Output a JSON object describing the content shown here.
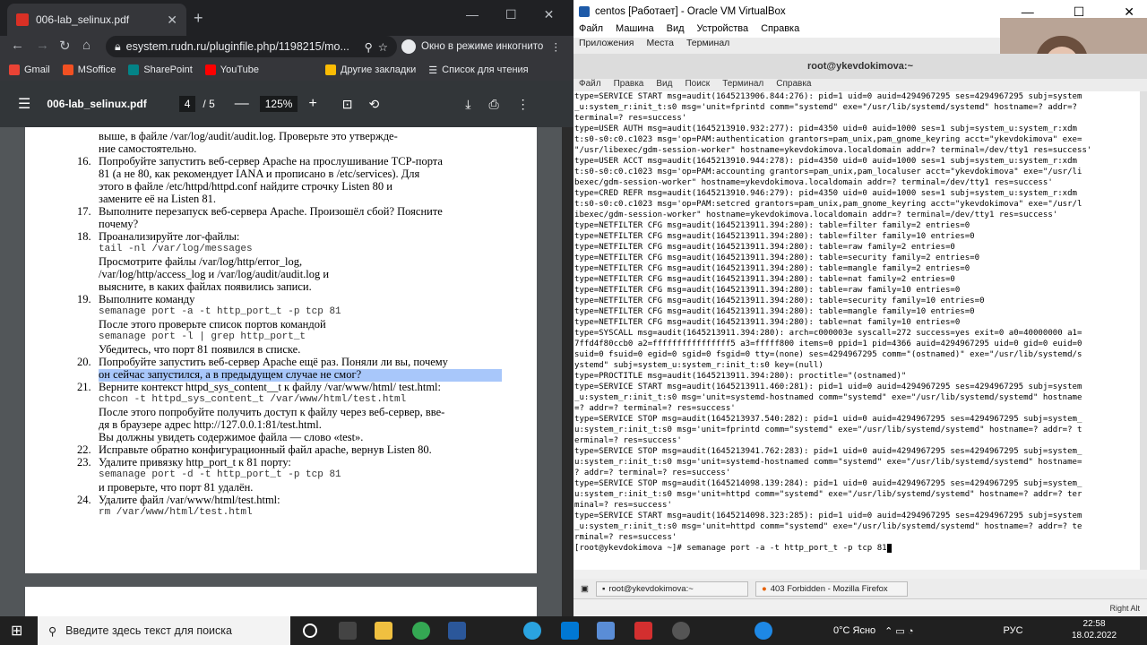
{
  "chrome": {
    "tab_title": "006-lab_selinux.pdf",
    "url": "esystem.rudn.ru/pluginfile.php/1198215/mo...",
    "incognito": "Окно в режиме инкогнито",
    "bookmarks": [
      "Gmail",
      "MSoffice",
      "SharePoint",
      "YouTube",
      "Другие закладки",
      "Список для чтения"
    ]
  },
  "pdf": {
    "title": "006-lab_selinux.pdf",
    "page": "4",
    "total": "/ 5",
    "zoom": "125%",
    "items": [
      {
        "n": "",
        "lines": [
          "выше, в файле /var/log/audit/audit.log. Проверьте это утвержде-",
          "ние самостоятельно."
        ]
      },
      {
        "n": "16.",
        "lines": [
          "Попробуйте запустить веб-сервер Apache на прослушивание TCP-порта",
          "81 (а не 80, как рекомендует IANA и прописано в /etc/services). Для",
          "этого в файле /etc/httpd/httpd.conf найдите строчку Listen 80 и",
          "замените её на Listen 81."
        ]
      },
      {
        "n": "17.",
        "lines": [
          "Выполните перезапуск веб-сервера Apache. Произошёл сбой? Поясните",
          "почему?"
        ]
      },
      {
        "n": "18.",
        "lines": [
          "Проанализируйте лог-файлы:",
          "tail -nl /var/log/messages",
          "Просмотрите файлы /var/log/http/error_log,",
          "/var/log/http/access_log и /var/log/audit/audit.log и",
          "выясните, в каких файлах появились записи."
        ]
      },
      {
        "n": "19.",
        "lines": [
          "Выполните команду",
          "semanage port -a -t http_port_t -p tcp 81",
          "После этого проверьте список портов командой",
          "semanage port -l | grep http_port_t",
          "Убедитесь, что порт 81 появился в списке."
        ]
      },
      {
        "n": "20.",
        "lines": [
          "Попробуйте запустить веб-сервер Apache ещё раз. Поняли ли вы, почему",
          "он сейчас запустился, а в предыдущем случае не смог?"
        ]
      },
      {
        "n": "21.",
        "lines": [
          "Верните контекст httpd_sys_content__t к файлу /var/www/html/ test.html:",
          "chcon -t httpd_sys_content_t /var/www/html/test.html",
          "После этого попробуйте получить доступ к файлу через веб-сервер, вве-",
          "дя в браузере адрес http://127.0.0.1:81/test.html.",
          "Вы должны увидеть содержимое файла — слово «test»."
        ]
      },
      {
        "n": "22.",
        "lines": [
          "Исправьте обратно конфигурационный файл apache, вернув Listen 80."
        ]
      },
      {
        "n": "23.",
        "lines": [
          "Удалите привязку http_port_t к 81 порту:",
          "semanage port -d -t http_port_t -p tcp 81",
          "и проверьте, что порт 81 удалён."
        ]
      },
      {
        "n": "24.",
        "lines": [
          "Удалите файл /var/www/html/test.html:",
          "rm /var/www/html/test.html"
        ]
      }
    ]
  },
  "vbox": {
    "title": "centos [Работает] - Oracle VM VirtualBox",
    "menu": [
      "Файл",
      "Машина",
      "Вид",
      "Устройства",
      "Справка"
    ],
    "gnome": [
      "Приложения",
      "Места",
      "Терминал"
    ],
    "term_title": "root@ykevdokimova:~",
    "term_menu": [
      "Файл",
      "Правка",
      "Вид",
      "Поиск",
      "Терминал",
      "Справка"
    ],
    "term_text": "type=SERVICE START msg=audit(1645213906.844:276): pid=1 uid=0 auid=4294967295 ses=4294967295 subj=system\n_u:system_r:init_t:s0 msg='unit=fprintd comm=\"systemd\" exe=\"/usr/lib/systemd/systemd\" hostname=? addr=?\nterminal=? res=success'\ntype=USER AUTH msg=audit(1645213910.932:277): pid=4350 uid=0 auid=1000 ses=1 subj=system_u:system_r:xdm\nt:s0-s0:c0.c1023 msg='op=PAM:authentication grantors=pam_unix,pam_gnome_keyring acct=\"ykevdokimova\" exe=\n\"/usr/libexec/gdm-session-worker\" hostname=ykevdokimova.localdomain addr=? terminal=/dev/tty1 res=success'\ntype=USER ACCT msg=audit(1645213910.944:278): pid=4350 uid=0 auid=1000 ses=1 subj=system_u:system_r:xdm\nt:s0-s0:c0.c1023 msg='op=PAM:accounting grantors=pam_unix,pam_localuser acct=\"ykevdokimova\" exe=\"/usr/li\nbexec/gdm-session-worker\" hostname=ykevdokimova.localdomain addr=? terminal=/dev/tty1 res=success'\ntype=CRED REFR msg=audit(1645213910.946:279): pid=4350 uid=0 auid=1000 ses=1 subj=system_u:system_r:xdm\nt:s0-s0:c0.c1023 msg='op=PAM:setcred grantors=pam_unix,pam_gnome_keyring acct=\"ykevdokimova\" exe=\"/usr/l\nibexec/gdm-session-worker\" hostname=ykevdokimova.localdomain addr=? terminal=/dev/tty1 res=success'\ntype=NETFILTER CFG msg=audit(1645213911.394:280): table=filter family=2 entries=0\ntype=NETFILTER CFG msg=audit(1645213911.394:280): table=filter family=10 entries=0\ntype=NETFILTER CFG msg=audit(1645213911.394:280): table=raw family=2 entries=0\ntype=NETFILTER CFG msg=audit(1645213911.394:280): table=security family=2 entries=0\ntype=NETFILTER CFG msg=audit(1645213911.394:280): table=mangle family=2 entries=0\ntype=NETFILTER CFG msg=audit(1645213911.394:280): table=nat family=2 entries=0\ntype=NETFILTER CFG msg=audit(1645213911.394:280): table=raw family=10 entries=0\ntype=NETFILTER CFG msg=audit(1645213911.394:280): table=security family=10 entries=0\ntype=NETFILTER CFG msg=audit(1645213911.394:280): table=mangle family=10 entries=0\ntype=NETFILTER CFG msg=audit(1645213911.394:280): table=nat family=10 entries=0\ntype=SYSCALL msg=audit(1645213911.394:280): arch=c000003e syscall=272 success=yes exit=0 a0=40000000 a1=\n7ffd4f80ccb0 a2=ffffffffffffffff5 a3=fffff800 items=0 ppid=1 pid=4366 auid=4294967295 uid=0 gid=0 euid=0\nsuid=0 fsuid=0 egid=0 sgid=0 fsgid=0 tty=(none) ses=4294967295 comm=\"(ostnamed)\" exe=\"/usr/lib/systemd/s\nystemd\" subj=system_u:system_r:init_t:s0 key=(null)\ntype=PROCTITLE msg=audit(1645213911.394:280): proctitle=\"(ostnamed)\"\ntype=SERVICE START msg=audit(1645213911.460:281): pid=1 uid=0 auid=4294967295 ses=4294967295 subj=system\n_u:system_r:init_t:s0 msg='unit=systemd-hostnamed comm=\"systemd\" exe=\"/usr/lib/systemd/systemd\" hostname\n=? addr=? terminal=? res=success'\ntype=SERVICE STOP msg=audit(1645213937.540:282): pid=1 uid=0 auid=4294967295 ses=4294967295 subj=system_\nu:system_r:init_t:s0 msg='unit=fprintd comm=\"systemd\" exe=\"/usr/lib/systemd/systemd\" hostname=? addr=? t\nerminal=? res=success'\ntype=SERVICE STOP msg=audit(1645213941.762:283): pid=1 uid=0 auid=4294967295 ses=4294967295 subj=system_\nu:system_r:init_t:s0 msg='unit=systemd-hostnamed comm=\"systemd\" exe=\"/usr/lib/systemd/systemd\" hostname=\n? addr=? terminal=? res=success'\ntype=SERVICE STOP msg=audit(1645214098.139:284): pid=1 uid=0 auid=4294967295 ses=4294967295 subj=system_\nu:system_r:init_t:s0 msg='unit=httpd comm=\"systemd\" exe=\"/usr/lib/systemd/systemd\" hostname=? addr=? ter\nminal=? res=success'\ntype=SERVICE START msg=audit(1645214098.323:285): pid=1 uid=0 auid=4294967295 ses=4294967295 subj=system\n_u:system_r:init_t:s0 msg='unit=httpd comm=\"systemd\" exe=\"/usr/lib/systemd/systemd\" hostname=? addr=? te\nrminal=? res=success'",
    "prompt": "[root@ykevdokimova ~]# semanage port -a -t http_port_t -p tcp 81",
    "tasks": [
      "root@ykevdokimova:~",
      "403 Forbidden - Mozilla Firefox"
    ],
    "host_key": "Right Alt"
  },
  "windows": {
    "search_placeholder": "Введите здесь текст для поиска",
    "weather": "0°C Ясно",
    "lang": "РУС",
    "time": "22:58",
    "date": "18.02.2022"
  }
}
